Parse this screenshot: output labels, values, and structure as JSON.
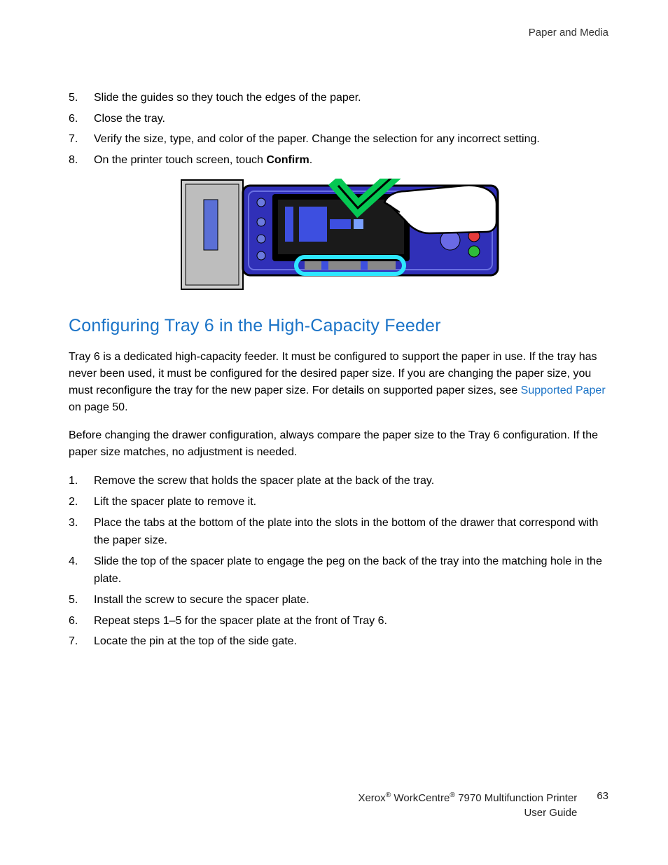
{
  "header": {
    "section": "Paper and Media"
  },
  "steps_top": [
    {
      "n": "5.",
      "text": "Slide the guides so they touch the edges of the paper."
    },
    {
      "n": "6.",
      "text": "Close the tray."
    },
    {
      "n": "7.",
      "text": "Verify the size, type, and color of the paper. Change the selection for any incorrect setting."
    },
    {
      "n": "8.",
      "text_pre": "On the printer touch screen, touch ",
      "bold": "Confirm",
      "text_post": "."
    }
  ],
  "section_heading": "Configuring Tray 6 in the High-Capacity Feeder",
  "para1_pre": "Tray 6 is a dedicated high-capacity feeder. It must be configured to support the paper in use. If the tray has never been used, it must be configured for the desired paper size. If you are changing the paper size, you must reconfigure the tray for the new paper size. For details on supported paper sizes, see ",
  "para1_link": "Supported Paper",
  "para1_post": " on page 50.",
  "para2": "Before changing the drawer configuration, always compare the paper size to the Tray 6 configuration. If the paper size matches, no adjustment is needed.",
  "steps_bottom": [
    {
      "n": "1.",
      "text": "Remove the screw that holds the spacer plate at the back of the tray."
    },
    {
      "n": "2.",
      "text": "Lift the spacer plate to remove it."
    },
    {
      "n": "3.",
      "text": "Place the tabs at the bottom of the plate into the slots in the bottom of the drawer that correspond with the paper size."
    },
    {
      "n": "4.",
      "text": "Slide the top of the spacer plate to engage the peg on the back of the tray into the matching hole in the plate."
    },
    {
      "n": "5.",
      "text": "Install the screw to secure the spacer plate."
    },
    {
      "n": "6.",
      "text": "Repeat steps 1–5 for the spacer plate at the front of Tray 6."
    },
    {
      "n": "7.",
      "text": "Locate the pin at the top of the side gate."
    }
  ],
  "footer": {
    "brand1": "Xerox",
    "brand2": " WorkCentre",
    "model": " 7970 Multifunction Printer",
    "line2": "User Guide",
    "page": "63"
  }
}
